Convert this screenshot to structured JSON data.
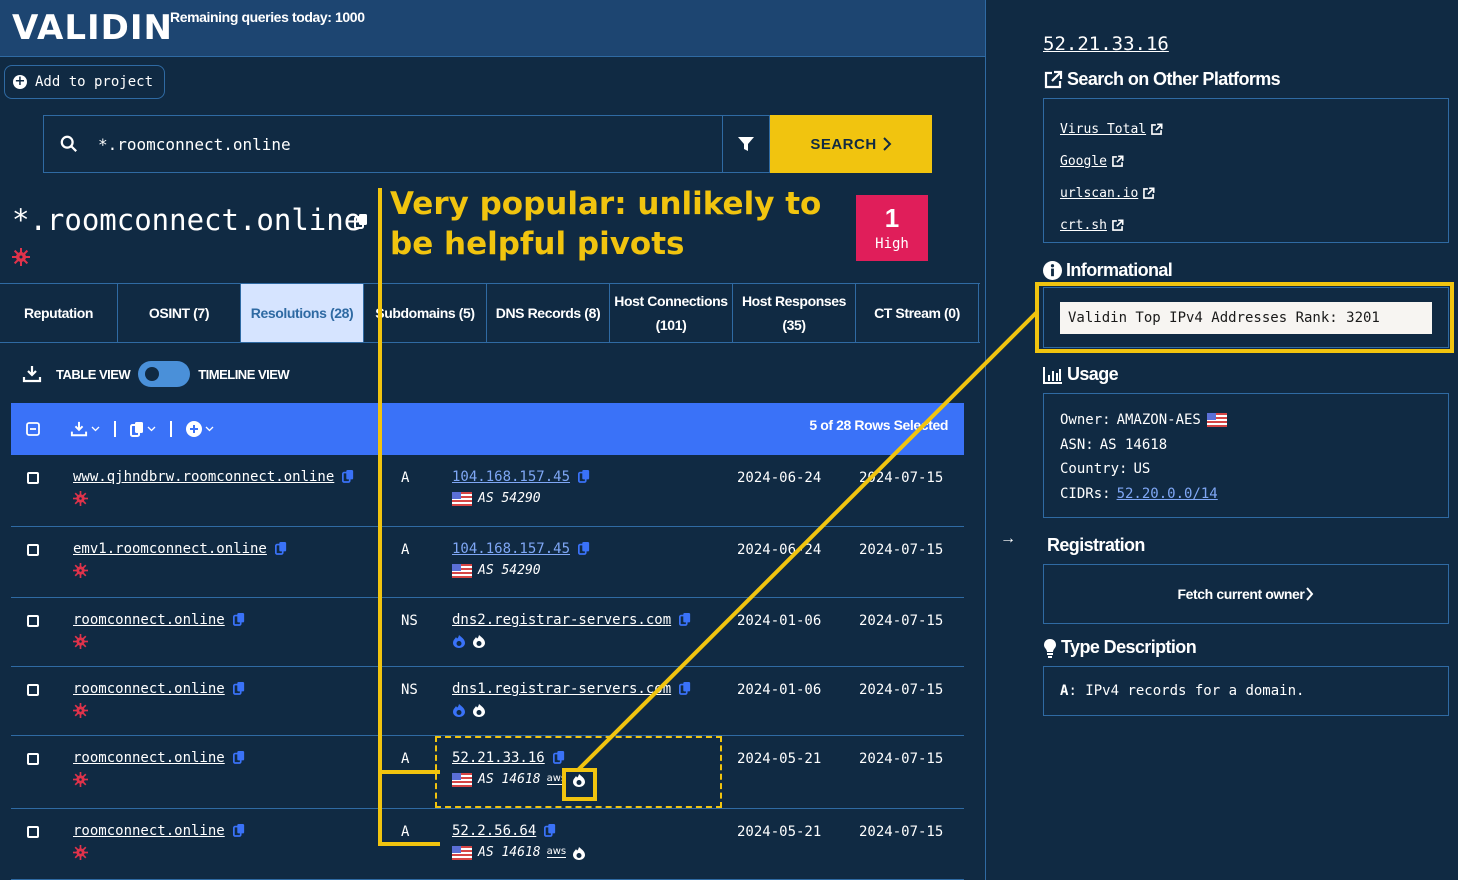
{
  "header": {
    "logo": "VALIDIN",
    "remaining_queries": "Remaining queries today: 1000"
  },
  "actions": {
    "add_to_project": "Add to project"
  },
  "search": {
    "value": "*.roomconnect.online",
    "placeholder": "",
    "button_label": "SEARCH"
  },
  "result": {
    "title": "*.roomconnect.online",
    "risk_count": "1",
    "risk_level": "High"
  },
  "annotation": {
    "text": "Very popular: unlikely to be helpful pivots",
    "color": "#f1c40f"
  },
  "tabs": [
    {
      "label": "Reputation",
      "active": false
    },
    {
      "label": "OSINT (7)",
      "active": false
    },
    {
      "label": "Resolutions (28)",
      "active": true
    },
    {
      "label": "Subdomains (5)",
      "active": false
    },
    {
      "label": "DNS Records (8)",
      "active": false
    },
    {
      "label": "Host Connections (101)",
      "active": false
    },
    {
      "label": "Host Responses (35)",
      "active": false
    },
    {
      "label": "CT Stream (0)",
      "active": false
    }
  ],
  "view": {
    "table_label": "TABLE VIEW",
    "timeline_label": "TIMELINE VIEW"
  },
  "table": {
    "rows_selected": "5 of 28 Rows Selected",
    "rows": [
      {
        "host": "www.qjhndbrw.roomconnect.online",
        "type": "A",
        "value": "104.168.157.45",
        "kind": "ip",
        "asn": "AS 54290",
        "aws": false,
        "popular": false,
        "first_seen": "2024-06-24",
        "last_seen": "2024-07-15"
      },
      {
        "host": "emv1.roomconnect.online",
        "type": "A",
        "value": "104.168.157.45",
        "kind": "ip",
        "asn": "AS 54290",
        "aws": false,
        "popular": false,
        "first_seen": "2024-06-24",
        "last_seen": "2024-07-15"
      },
      {
        "host": "roomconnect.online",
        "type": "NS",
        "value": "dns2.registrar-servers.com",
        "kind": "ns",
        "first_seen": "2024-01-06",
        "last_seen": "2024-07-15"
      },
      {
        "host": "roomconnect.online",
        "type": "NS",
        "value": "dns1.registrar-servers.com",
        "kind": "ns",
        "first_seen": "2024-01-06",
        "last_seen": "2024-07-15"
      },
      {
        "host": "roomconnect.online",
        "type": "A",
        "value": "52.21.33.16",
        "kind": "ip",
        "asn": "AS 14618",
        "aws": true,
        "aws_label": "aws",
        "popular": true,
        "first_seen": "2024-05-21",
        "last_seen": "2024-07-15"
      },
      {
        "host": "roomconnect.online",
        "type": "A",
        "value": "52.2.56.64",
        "kind": "ip",
        "asn": "AS 14618",
        "aws": true,
        "aws_label": "aws",
        "popular": true,
        "first_seen": "2024-05-21",
        "last_seen": "2024-07-15"
      }
    ]
  },
  "sidebar": {
    "ip": "52.21.33.16",
    "platforms_heading": "Search on Other Platforms",
    "platforms": [
      "Virus Total",
      "Google",
      "urlscan.io",
      "crt.sh"
    ],
    "informational_heading": "Informational",
    "informational_text": "Validin Top IPv4 Addresses Rank: 3201",
    "usage_heading": "Usage",
    "usage": {
      "owner_label": "Owner:",
      "owner": "AMAZON-AES",
      "asn_label": "ASN:",
      "asn": "AS 14618",
      "country_label": "Country:",
      "country": "US",
      "cidrs_label": "CIDRs:",
      "cidrs": "52.20.0.0/14"
    },
    "registration_heading": "Registration",
    "fetch_owner": "Fetch current owner",
    "type_heading": "Type Description",
    "type_key": "A",
    "type_text": ": IPv4 records for a domain."
  }
}
